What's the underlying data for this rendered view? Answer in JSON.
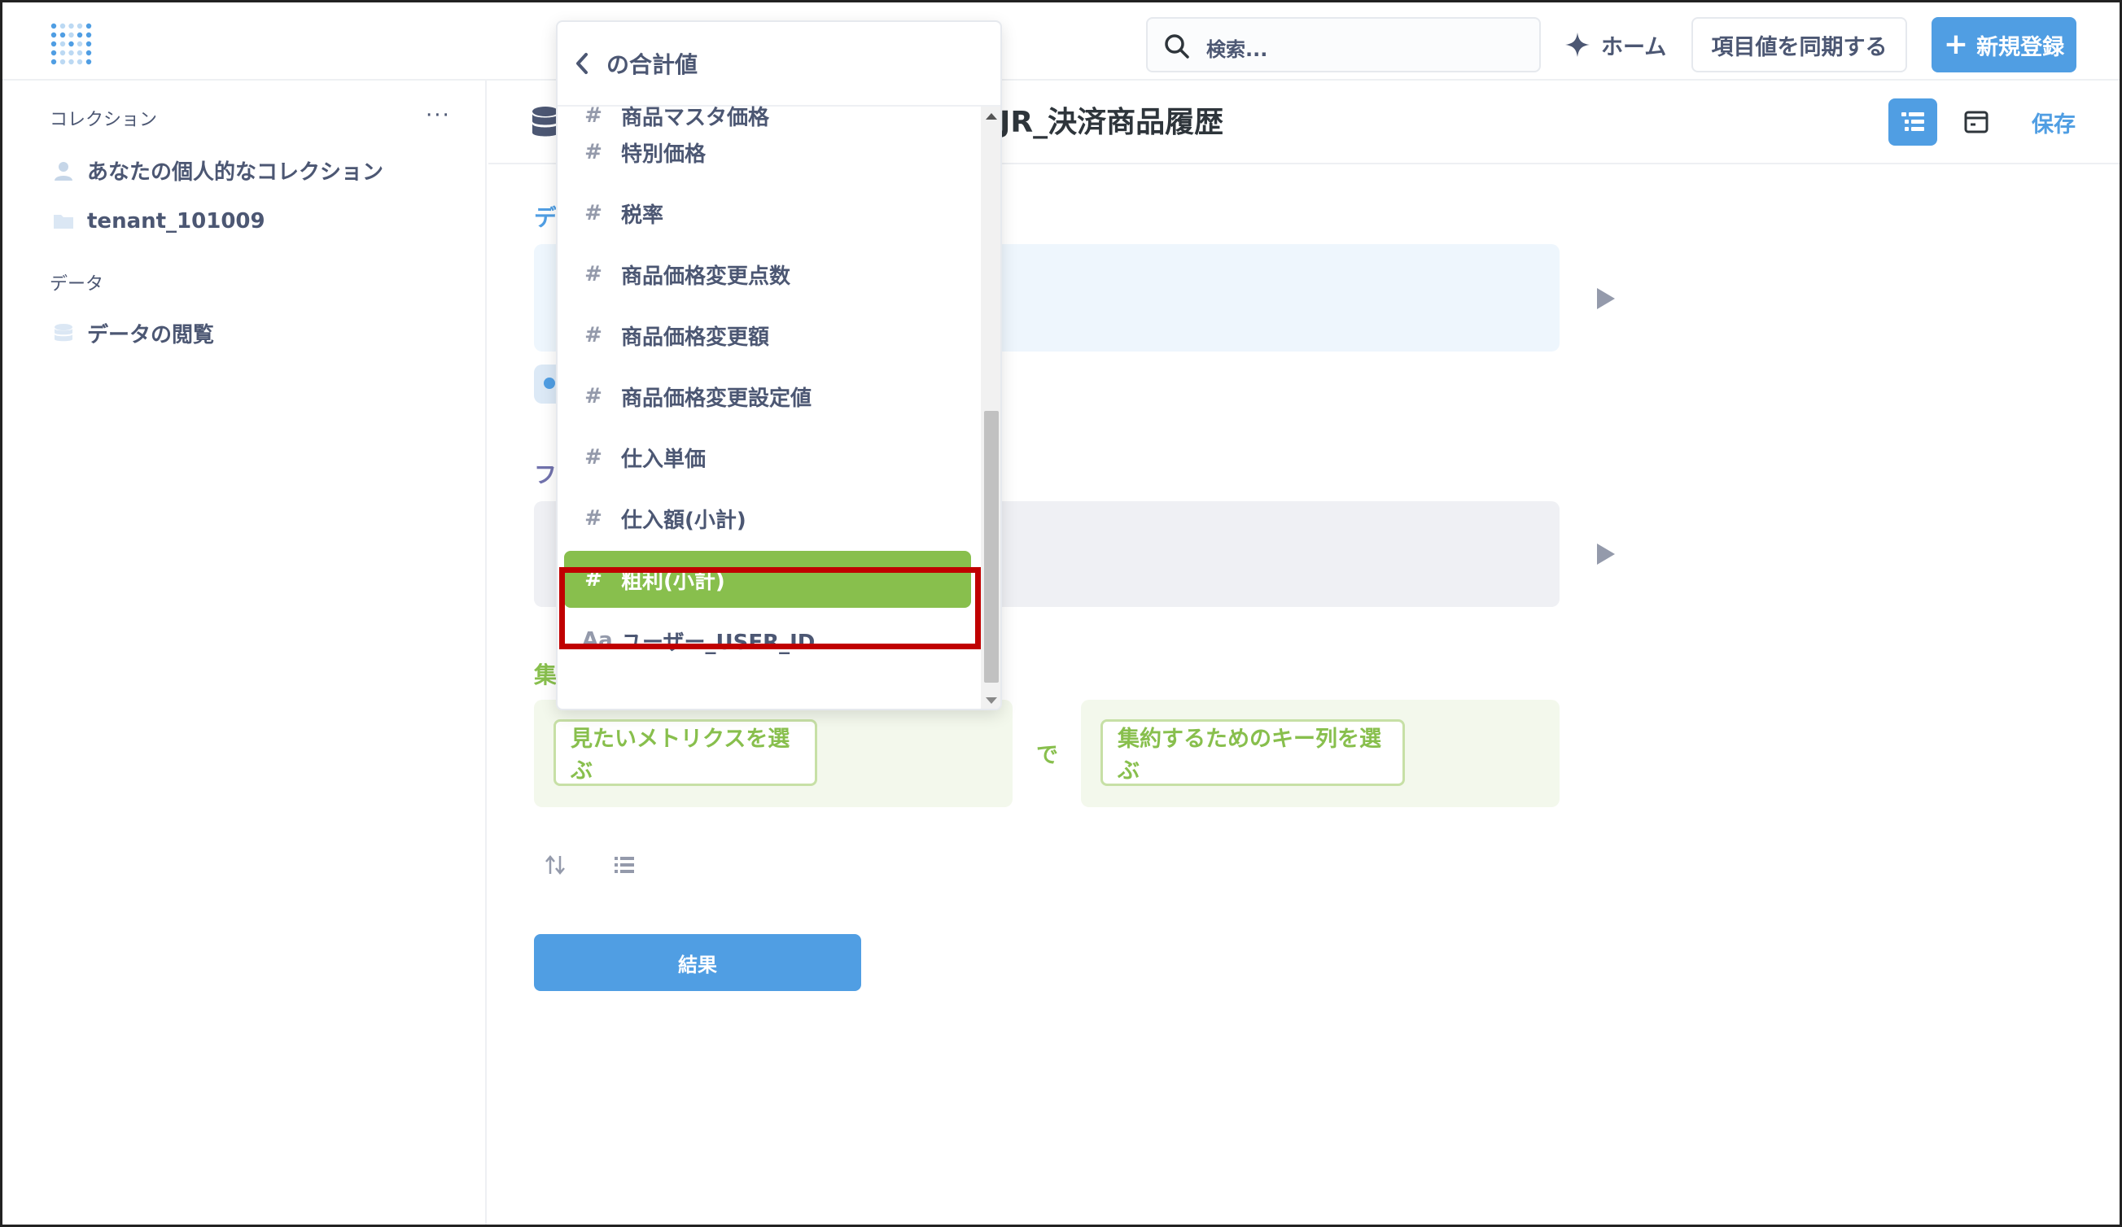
{
  "header": {
    "search_placeholder": "検索...",
    "home_label": "ホーム",
    "sync_label": "項目値を同期する",
    "new_label": "新規登録"
  },
  "sidebar": {
    "collections_heading": "コレクション",
    "more_label": "···",
    "items": [
      {
        "label": "あなたの個人的なコレクション",
        "icon": "person-icon"
      },
      {
        "label": "tenant_101009",
        "icon": "folder-icon"
      }
    ],
    "data_heading": "データ",
    "data_items": [
      {
        "label": "データの閲覧",
        "icon": "database-icon"
      }
    ]
  },
  "main": {
    "title": "JR_決済商品履歴",
    "save_label": "保存",
    "data_section_label": "デ",
    "filter_section_label": "フ",
    "summarize_section_label": "集",
    "metric_button_label": "見たいメトリクスを選ぶ",
    "by_label": "で",
    "group_button_label": "集約するためのキー列を選ぶ",
    "result_button_label": "結果"
  },
  "popover": {
    "title": "の合計値",
    "items": [
      {
        "icon": "#",
        "label": "商品マスタ価格"
      },
      {
        "icon": "#",
        "label": "特別価格"
      },
      {
        "icon": "#",
        "label": "税率"
      },
      {
        "icon": "#",
        "label": "商品価格変更点数"
      },
      {
        "icon": "#",
        "label": "商品価格変更額"
      },
      {
        "icon": "#",
        "label": "商品価格変更設定値"
      },
      {
        "icon": "#",
        "label": "仕入単価"
      },
      {
        "icon": "#",
        "label": "仕入額(小計)"
      },
      {
        "icon": "#",
        "label": "粗利(小計)",
        "selected": true
      },
      {
        "icon": "Aa",
        "label": "ユーザー_USER_ID"
      }
    ]
  },
  "colors": {
    "brand_blue": "#509ee3",
    "summarize_green": "#88bf4d",
    "highlight_red": "#c00000",
    "data_step_bg": "#eef6fd",
    "filter_step_bg": "#eff0f4",
    "summarize_step_bg": "#f3f8ec"
  }
}
